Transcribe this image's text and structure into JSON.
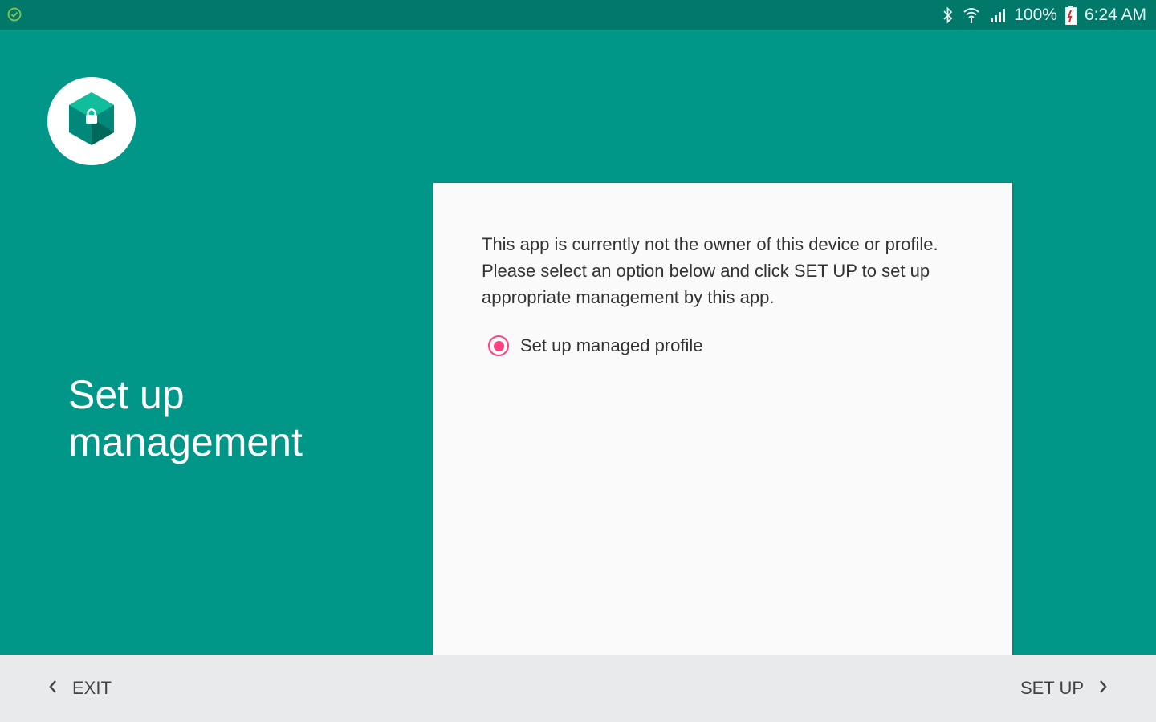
{
  "status_bar": {
    "battery": "100%",
    "time": "6:24 AM",
    "icons": [
      "check-circle-icon",
      "bluetooth-icon",
      "wifi-icon",
      "signal-icon",
      "battery-icon"
    ]
  },
  "header": {
    "title": "Set up management",
    "logo_icon": "shield-lock-icon"
  },
  "card": {
    "message": "This app is currently not the owner of this device or profile. Please select an option below and click SET UP to set up appropriate management by this app.",
    "options": [
      {
        "label": "Set up managed profile",
        "selected": true
      }
    ]
  },
  "footer": {
    "exit_label": "EXIT",
    "setup_label": "SET UP"
  },
  "colors": {
    "primary": "#009688",
    "primary_dark": "#00796b",
    "accent": "#ff4081",
    "card": "#fafafa",
    "footer": "#e8eaeb"
  }
}
